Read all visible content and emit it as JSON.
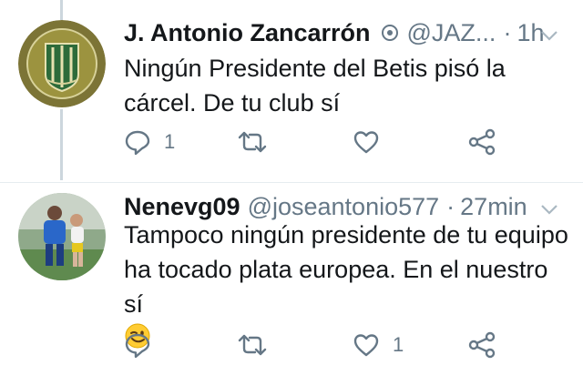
{
  "tweets": [
    {
      "display_name": "J. Antonio Zancarrón",
      "handle": "@JAZ...",
      "separator": "·",
      "time": "1h",
      "text": "Ningún Presidente del Betis pisó la cárcel. De tu club sí",
      "reply_count": "1",
      "retweet_count": "",
      "like_count": "",
      "verified_badge": true,
      "avatar_icon": "club-crest-avatar"
    },
    {
      "display_name": "Nenevg09",
      "handle": "@joseantonio577",
      "separator": "·",
      "time": "27min",
      "text": "Tampoco ningún presidente de tu equipo ha tocado plata europea. En el nuestro sí",
      "emoji": "winking-face",
      "reply_count": "",
      "retweet_count": "",
      "like_count": "1",
      "avatar_icon": "football-players-avatar"
    }
  ],
  "colors": {
    "text": "#14171a",
    "secondary": "#657786",
    "icon": "#657786",
    "thread_line": "#ccd6dd"
  }
}
